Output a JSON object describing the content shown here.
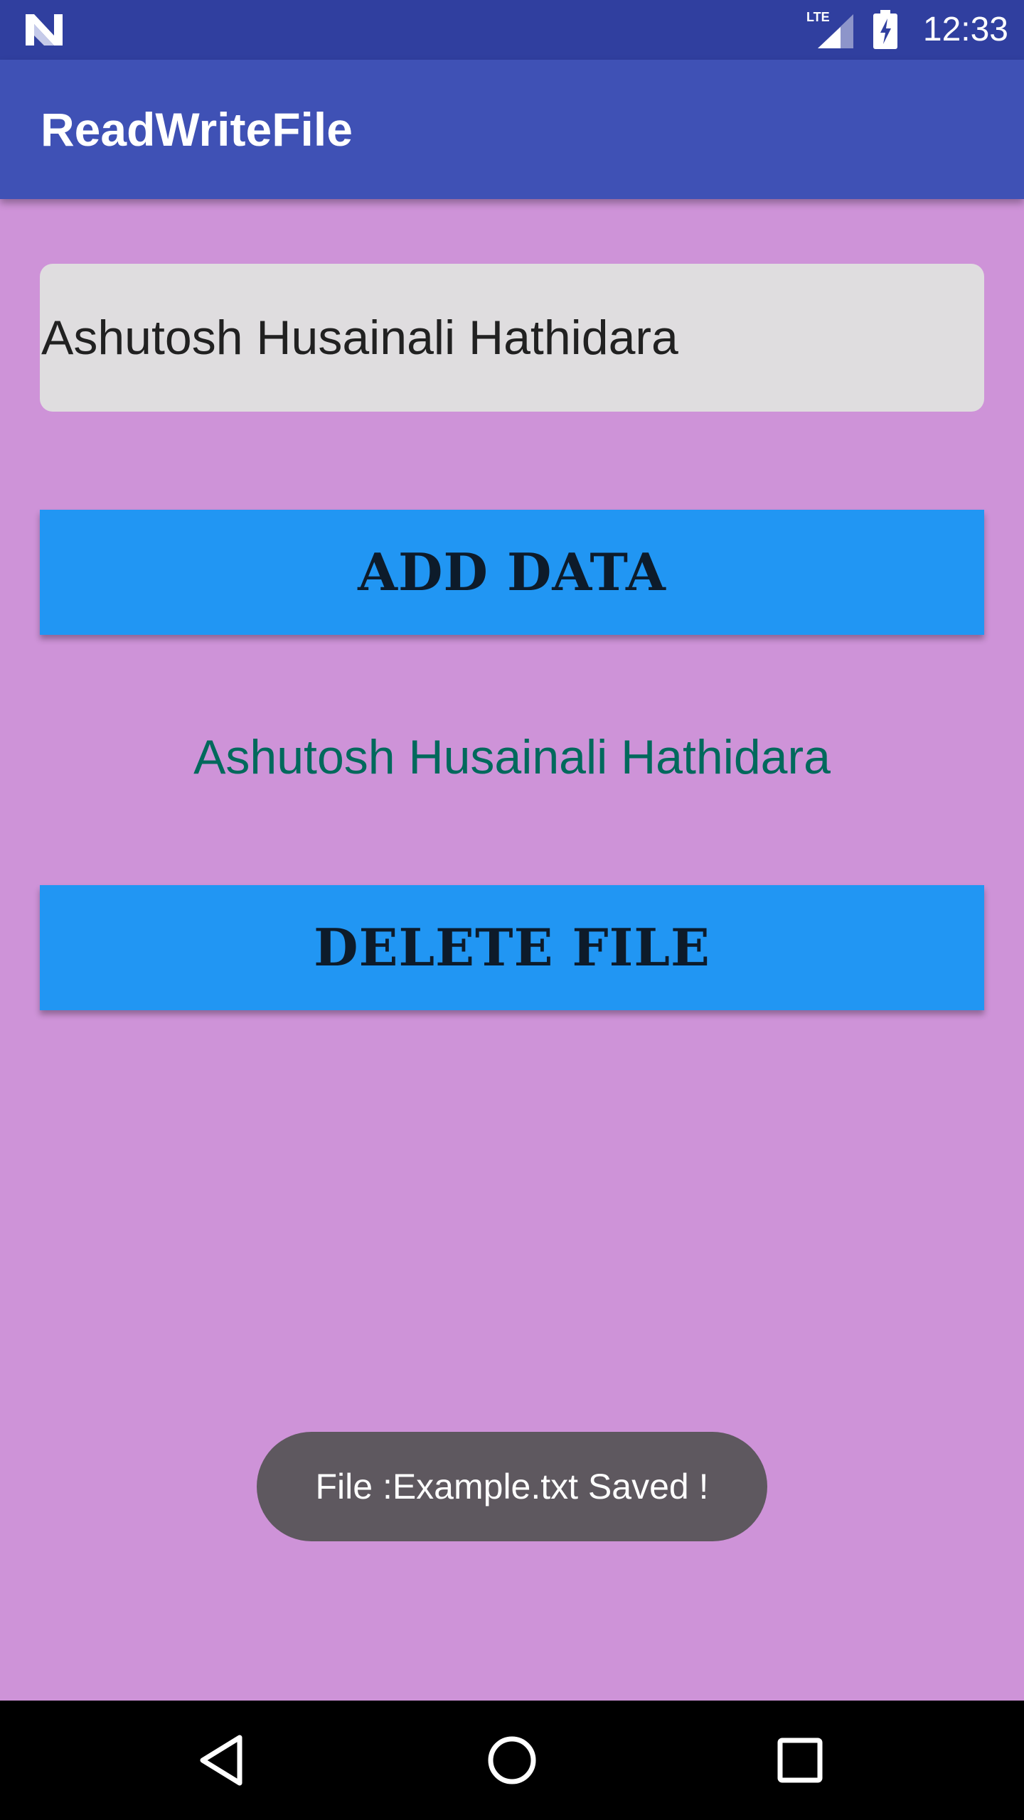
{
  "status_bar": {
    "time": "12:33",
    "network": "LTE",
    "icons": [
      "android-n-icon",
      "lte-signal-icon",
      "battery-charging-icon"
    ]
  },
  "app_bar": {
    "title": "ReadWriteFile"
  },
  "main": {
    "input_value": "Ashutosh Husainali Hathidara",
    "add_button_label": "ADD DATA",
    "output_text": "Ashutosh Husainali Hathidara",
    "delete_button_label": "DELETE FILE"
  },
  "toast": {
    "message": "File :Example.txt Saved !"
  },
  "nav_bar": {
    "icons": [
      "back-icon",
      "home-icon",
      "recents-icon"
    ]
  },
  "colors": {
    "status_bar": "#303F9F",
    "app_bar": "#3F51B5",
    "background": "#CE93D8",
    "button": "#2196F3",
    "input_background": "#DFDDDF",
    "output_text": "#00695C",
    "toast": "#5E585F"
  }
}
